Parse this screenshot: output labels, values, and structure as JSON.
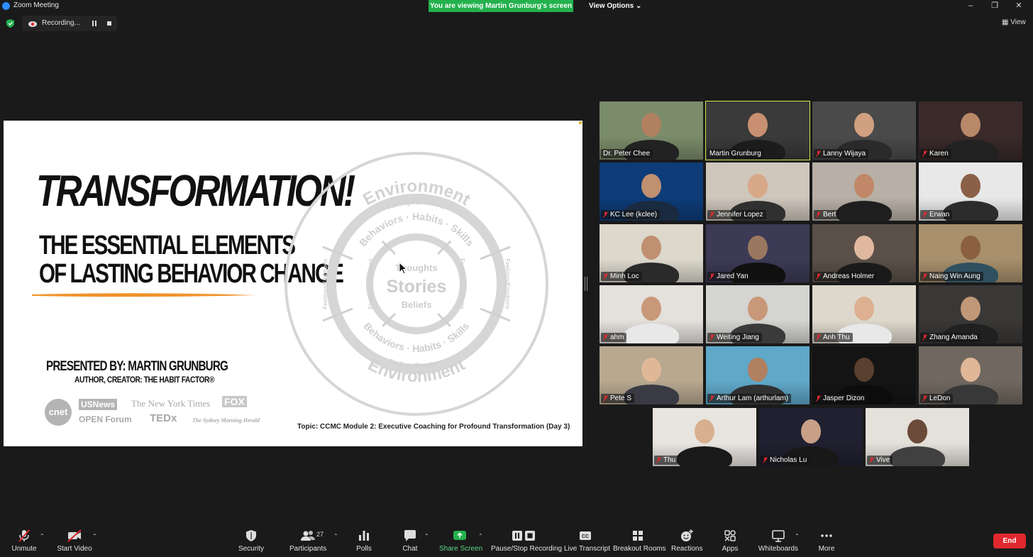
{
  "window": {
    "title": "Zoom Meeting",
    "viewing_banner": "You are viewing Martin Grunburg's screen",
    "view_options": "View Options",
    "view_label": "View"
  },
  "recording": {
    "label": "Recording..."
  },
  "slide": {
    "title": "TRANSFORMATION!",
    "subtitle_line1": "THE ESSENTIAL  ELEMENTS",
    "subtitle_line2": "OF LASTING BEHAVIOR CHANGE",
    "presented_by": "PRESENTED BY: MARTIN GRUNBURG",
    "author": "AUTHOR, CREATOR: THE HABIT FACTOR®",
    "topic": "Topic: CCMC Module 2: Executive Coaching for Profound Transformation (Day 3)",
    "logos": [
      "cnet",
      "USNews",
      "The New York Times",
      "FOX",
      "OPEN Forum",
      "TEDx",
      "The Sydney Morning Herald"
    ],
    "diagram": {
      "outer_top": "Environment",
      "outer_bottom": "Environment",
      "ring1_top": "Feelings/Emotions",
      "ring1_bottom": "Feelings/Emotions",
      "ring1_left": "Feelings/Emotions",
      "ring1_right": "Feelings/Emotions",
      "ring2_top": "Behaviors · Habits · Skills",
      "ring2_bottom": "Behaviors · Habits · Skills",
      "ring2_left": "Feelings/Emotions",
      "ring2_right": "Feelings/Emotions",
      "inner_top": "Thoughts",
      "center": "Stories",
      "inner_bottom": "Beliefs"
    }
  },
  "participants": [
    {
      "name": "Dr. Peter Chee",
      "muted": false,
      "active": false,
      "bg": "#7a8c6a",
      "skin": "#b08060",
      "shirt": "#222"
    },
    {
      "name": "Martin Grunburg",
      "muted": false,
      "active": true,
      "bg": "#3a3a3a",
      "skin": "#c89070",
      "shirt": "#1c1c1c"
    },
    {
      "name": "Lanny Wijaya",
      "muted": true,
      "active": false,
      "bg": "#4a4a4a",
      "skin": "#d0a080",
      "shirt": "#2a2a2a"
    },
    {
      "name": "Karen",
      "muted": true,
      "active": false,
      "bg": "#3a2a2a",
      "skin": "#b88868",
      "shirt": "#222"
    },
    {
      "name": "KC Lee (kclee)",
      "muted": true,
      "active": false,
      "bg": "#0d3c78",
      "skin": "#c09070",
      "shirt": "#1a2a40"
    },
    {
      "name": "Jennifer Lopez",
      "muted": true,
      "active": false,
      "bg": "#cfc6bc",
      "skin": "#d8a888",
      "shirt": "#303030"
    },
    {
      "name": "Bert",
      "muted": true,
      "active": false,
      "bg": "#b8b0a6",
      "skin": "#c08868",
      "shirt": "#1e1e1e"
    },
    {
      "name": "Erwan",
      "muted": true,
      "active": false,
      "bg": "#e8e8e8",
      "skin": "#8a6048",
      "shirt": "#2c2c2c"
    },
    {
      "name": "Minh Loc",
      "muted": true,
      "active": false,
      "bg": "#dcd8cc",
      "skin": "#c09070",
      "shirt": "#2a2a2a"
    },
    {
      "name": "Jared Yan",
      "muted": true,
      "active": false,
      "bg": "#3c3a55",
      "skin": "#9a7860",
      "shirt": "#101010"
    },
    {
      "name": "Andreas Holmer",
      "muted": true,
      "active": false,
      "bg": "#5a5048",
      "skin": "#e0b8a0",
      "shirt": "#1a1a1a"
    },
    {
      "name": "Naing Win Aung",
      "muted": true,
      "active": false,
      "bg": "#a8906c",
      "skin": "#8a6040",
      "shirt": "#305060"
    },
    {
      "name": "ahm",
      "muted": true,
      "active": false,
      "bg": "#e4e0dc",
      "skin": "#c89878",
      "shirt": "#e8e8e8"
    },
    {
      "name": "Weiting Jiang",
      "muted": true,
      "active": false,
      "bg": "#d4d4d0",
      "skin": "#c89878",
      "shirt": "#3a3a3a"
    },
    {
      "name": "Anh Thu",
      "muted": true,
      "active": false,
      "bg": "#ded8cc",
      "skin": "#dcb090",
      "shirt": "#e8e8e8"
    },
    {
      "name": "Zhang Amanda",
      "muted": true,
      "active": false,
      "bg": "#3a3836",
      "skin": "#c09878",
      "shirt": "#202020"
    },
    {
      "name": "Pete S",
      "muted": true,
      "active": false,
      "bg": "#b8a890",
      "skin": "#e0b898",
      "shirt": "#3a3a44"
    },
    {
      "name": "Arthur Lam (arthurlam)",
      "muted": true,
      "active": false,
      "bg": "#60a8c8",
      "skin": "#b08060",
      "shirt": "#303030"
    },
    {
      "name": "Jasper Dizon",
      "muted": true,
      "active": false,
      "bg": "#141414",
      "skin": "#5a4030",
      "shirt": "#0c0c0c"
    },
    {
      "name": "LeDon",
      "muted": true,
      "active": false,
      "bg": "#706860",
      "skin": "#e0b898",
      "shirt": "#383838"
    },
    {
      "name": "Thu",
      "muted": true,
      "active": false,
      "bg": "#e8e4e0",
      "skin": "#d8b090",
      "shirt": "#1a1a1a"
    },
    {
      "name": "Nicholas Lu",
      "muted": true,
      "active": false,
      "bg": "#202030",
      "skin": "#c8a088",
      "shirt": "#181818"
    },
    {
      "name": "Vive",
      "muted": true,
      "active": false,
      "bg": "#e4e0da",
      "skin": "#6a4a38",
      "shirt": "#404040"
    }
  ],
  "toolbar": {
    "unmute": "Unmute",
    "start_video": "Start Video",
    "security": "Security",
    "participants": "Participants",
    "participants_count": "27",
    "polls": "Polls",
    "chat": "Chat",
    "share_screen": "Share Screen",
    "pause_stop_recording": "Pause/Stop Recording",
    "live_transcript": "Live Transcript",
    "breakout_rooms": "Breakout Rooms",
    "reactions": "Reactions",
    "apps": "Apps",
    "whiteboards": "Whiteboards",
    "more": "More",
    "end": "End"
  },
  "colors": {
    "share_green": "#23b14d",
    "end_red": "#e0282e",
    "active_speaker": "#d8e646",
    "mute_red": "#e0282e"
  }
}
